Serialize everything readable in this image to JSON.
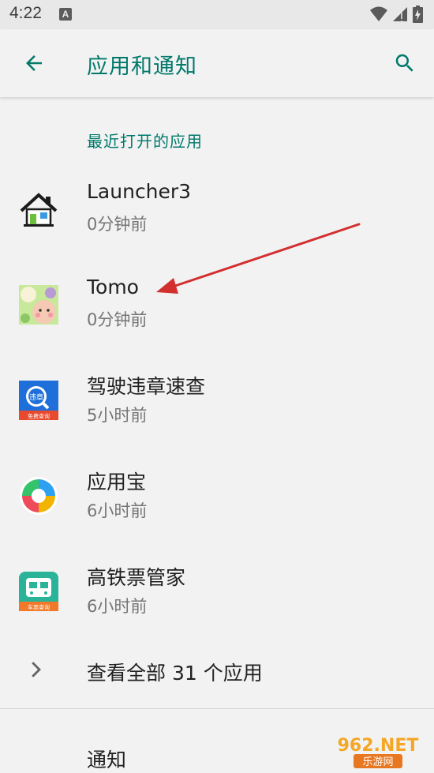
{
  "status_bar": {
    "time": "4:22",
    "notif_letter": "A"
  },
  "app_bar": {
    "title": "应用和通知"
  },
  "section": {
    "header": "最近打开的应用"
  },
  "apps": [
    {
      "name": "Launcher3",
      "time": "0分钟前",
      "icon": "launcher-house-icon"
    },
    {
      "name": "Tomo",
      "time": "0分钟前",
      "icon": "tomo-app-icon"
    },
    {
      "name": "驾驶违章速查",
      "time": "5小时前",
      "icon": "traffic-violation-app-icon",
      "icon_text_top": "违章",
      "icon_text_bottom": "免费查询"
    },
    {
      "name": "应用宝",
      "time": "6小时前",
      "icon": "yingyongbao-app-icon"
    },
    {
      "name": "高铁票管家",
      "time": "6小时前",
      "icon": "train-ticket-app-icon",
      "icon_text_bottom": "车票查询"
    }
  ],
  "see_all": {
    "label": "查看全部 31 个应用"
  },
  "notifications": {
    "label": "通知"
  },
  "watermark": {
    "main": "962.NET",
    "sub": "乐游网"
  },
  "colors": {
    "accent": "#00796b",
    "annotation_arrow": "#d32f2f"
  }
}
